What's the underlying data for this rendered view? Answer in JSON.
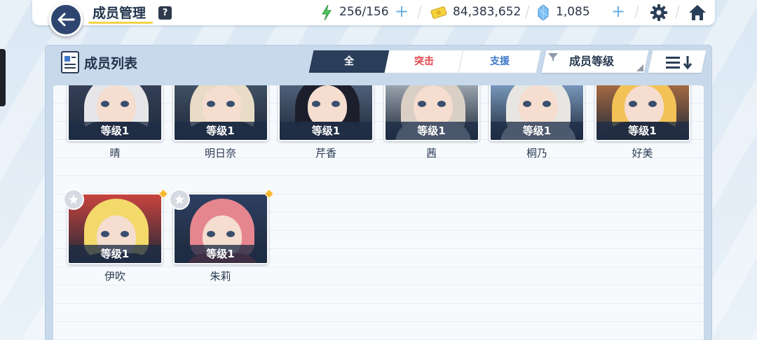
{
  "header": {
    "title": "成员管理",
    "help": "?"
  },
  "resources": {
    "ap": "256/156",
    "credits": "84,383,652",
    "pyroxene": "1,085"
  },
  "panel": {
    "title": "成员列表",
    "tabs": {
      "all": "全",
      "strike": "突击",
      "support": "支援"
    },
    "sort_label": "成员等级"
  },
  "students": [
    {
      "name": "晴",
      "level": "等级1",
      "hair": "#e6e6e8",
      "bg": "#3a4660",
      "outfit": "#2b2f3f"
    },
    {
      "name": "明日奈",
      "level": "等级1",
      "hair": "#e8dcc6",
      "bg": "#49596e",
      "outfit": "#2a3243"
    },
    {
      "name": "芹香",
      "level": "等级1",
      "hair": "#1c1f2b",
      "bg": "#5c6e8a",
      "outfit": "#2a2f3c"
    },
    {
      "name": "茜",
      "level": "等级1",
      "hair": "#d9cfc4",
      "bg": "#b9c3cc",
      "outfit": "#e8e8ea"
    },
    {
      "name": "桐乃",
      "level": "等级1",
      "hair": "#e8e6e2",
      "bg": "#8eb3dc",
      "outfit": "#f3f4f8"
    },
    {
      "name": "好美",
      "level": "等级1",
      "hair": "#f3c257",
      "bg": "#c77a45",
      "outfit": "#3a2e2e"
    },
    {
      "name": "伊吹",
      "level": "等级1",
      "hair": "#f3d86a",
      "bg": "#c9433e",
      "outfit": "#2b2b33"
    },
    {
      "name": "朱莉",
      "level": "等级1",
      "hair": "#e5868f",
      "bg": "#2e3f63",
      "outfit": "#b3383e"
    }
  ],
  "colors": {
    "accent_dark": "#2b3e59",
    "strike": "#e3474e",
    "support": "#3e78c9",
    "title_underline": "#f3d24a"
  }
}
